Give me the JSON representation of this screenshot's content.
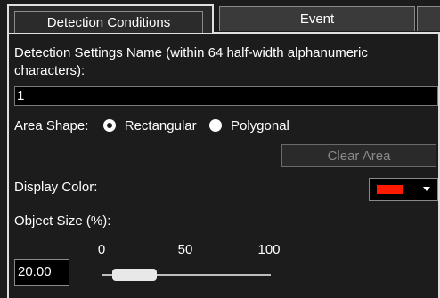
{
  "tabs": {
    "detection_label": "Detection Conditions",
    "event_label": "Event"
  },
  "detection": {
    "name_label": "Detection Settings Name (within 64 half-width alphanumeric",
    "name_label_line2": "characters):",
    "name_value": "1",
    "area_shape_label": "Area Shape:",
    "area_shape_options": [
      "Rectangular",
      "Polygonal"
    ],
    "area_shape_selected": "Rectangular",
    "clear_area_label": "Clear Area",
    "display_color_label": "Display Color:",
    "display_color_value": "#ff1a00",
    "object_size_label": "Object Size (%):",
    "slider_ticks": [
      "0",
      "50",
      "100"
    ],
    "object_size_value": "20.00",
    "slider_value": 20
  }
}
